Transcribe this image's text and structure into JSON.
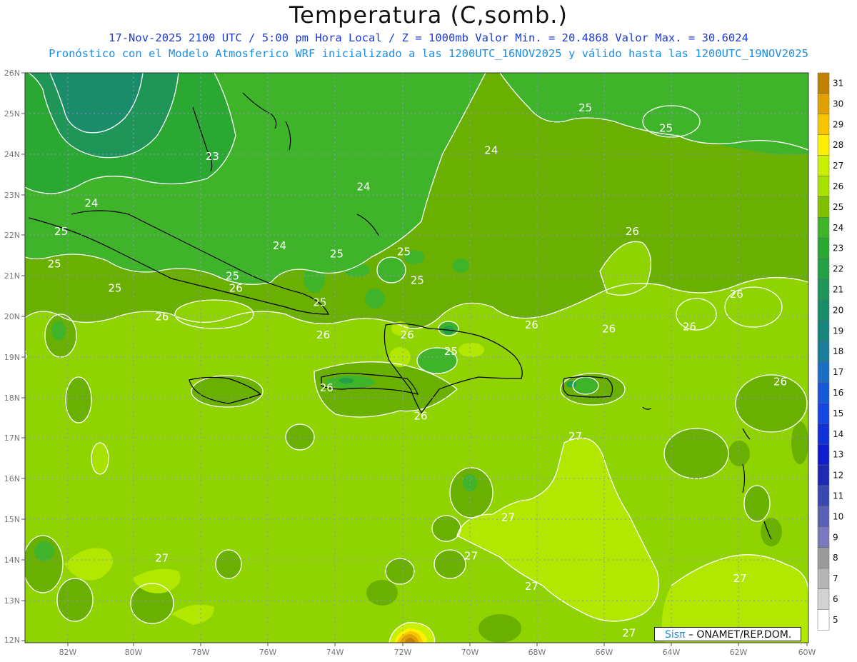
{
  "title": "Temperatura (C,somb.)",
  "subtitle_line1": "17-Nov-2025 2100 UTC / 5:00 pm Hora Local / Z = 1000mb   Valor Min. = 20.4868  Valor Max. = 30.6024",
  "subtitle_line2": "Pronóstico con el Modelo Atmosferico WRF inicializado a las 1200UTC_16NOV2025 y válido hasta las  1200UTC_19NOV2025",
  "lat_labels": [
    "26N",
    "25N",
    "24N",
    "23N",
    "22N",
    "21N",
    "20N",
    "19N",
    "18N",
    "17N",
    "16N",
    "15N",
    "14N",
    "13N",
    "12N"
  ],
  "lon_labels": [
    "82W",
    "80W",
    "78W",
    "76W",
    "74W",
    "72W",
    "70W",
    "68W",
    "66W",
    "64W",
    "62W",
    "60W"
  ],
  "colorbar": {
    "labels": [
      "31",
      "30",
      "29",
      "28",
      "27",
      "26",
      "25",
      "24",
      "23",
      "22",
      "21",
      "20",
      "19",
      "18",
      "17",
      "16",
      "15",
      "14",
      "13",
      "12",
      "11",
      "10",
      "9",
      "8",
      "7",
      "6",
      "5"
    ],
    "colors": [
      "#c08000",
      "#e0a000",
      "#f6c400",
      "#fff000",
      "#c8f000",
      "#a8e000",
      "#7ec000",
      "#3fb42a",
      "#2aa832",
      "#24a046",
      "#1f9658",
      "#1a8c6a",
      "#17857e",
      "#1a7e9a",
      "#1a6fc4",
      "#1658d8",
      "#1446e0",
      "#1232d8",
      "#0f1ecc",
      "#1e2ab4",
      "#3a48b0",
      "#5a60b4",
      "#7c78bc",
      "#9a9a9a",
      "#b4b4b4",
      "#d2d2d2",
      "#ffffff"
    ]
  },
  "contour_labels": [
    {
      "text": "25",
      "lon": -66.6,
      "lat": 25.05
    },
    {
      "text": "25",
      "lon": -64.2,
      "lat": 24.55
    },
    {
      "text": "24",
      "lon": -69.4,
      "lat": 24.0
    },
    {
      "text": "23",
      "lon": -77.7,
      "lat": 23.85
    },
    {
      "text": "24",
      "lon": -73.2,
      "lat": 23.1
    },
    {
      "text": "24",
      "lon": -81.3,
      "lat": 22.7
    },
    {
      "text": "25",
      "lon": -82.2,
      "lat": 22.0
    },
    {
      "text": "24",
      "lon": -75.7,
      "lat": 21.65
    },
    {
      "text": "26",
      "lon": -65.2,
      "lat": 22.0
    },
    {
      "text": "25",
      "lon": -74.0,
      "lat": 21.45
    },
    {
      "text": "25",
      "lon": -72.0,
      "lat": 21.5
    },
    {
      "text": "25",
      "lon": -82.4,
      "lat": 21.2
    },
    {
      "text": "25",
      "lon": -77.1,
      "lat": 20.9
    },
    {
      "text": "26",
      "lon": -77.0,
      "lat": 20.6
    },
    {
      "text": "25",
      "lon": -71.6,
      "lat": 20.8
    },
    {
      "text": "25",
      "lon": -80.6,
      "lat": 20.6
    },
    {
      "text": "26",
      "lon": -62.1,
      "lat": 20.45
    },
    {
      "text": "25",
      "lon": -74.5,
      "lat": 20.25
    },
    {
      "text": "26",
      "lon": -79.2,
      "lat": 19.9
    },
    {
      "text": "26",
      "lon": -68.2,
      "lat": 19.7
    },
    {
      "text": "26",
      "lon": -65.9,
      "lat": 19.6
    },
    {
      "text": "26",
      "lon": -63.5,
      "lat": 19.65
    },
    {
      "text": "26",
      "lon": -74.4,
      "lat": 19.45
    },
    {
      "text": "26",
      "lon": -71.9,
      "lat": 19.45
    },
    {
      "text": "25",
      "lon": -70.6,
      "lat": 19.05
    },
    {
      "text": "26",
      "lon": -83.4,
      "lat": 18.95
    },
    {
      "text": "26",
      "lon": -74.3,
      "lat": 18.15
    },
    {
      "text": "26",
      "lon": -60.8,
      "lat": 18.3
    },
    {
      "text": "26",
      "lon": -71.5,
      "lat": 17.45
    },
    {
      "text": "27",
      "lon": -66.9,
      "lat": 16.95
    },
    {
      "text": "27",
      "lon": -68.9,
      "lat": 14.95
    },
    {
      "text": "27",
      "lon": -79.2,
      "lat": 13.95
    },
    {
      "text": "27",
      "lon": -70.0,
      "lat": 14.0
    },
    {
      "text": "27",
      "lon": -62.0,
      "lat": 13.45
    },
    {
      "text": "27",
      "lon": -68.2,
      "lat": 13.25
    },
    {
      "text": "27",
      "lon": -65.3,
      "lat": 12.1
    }
  ],
  "credit": {
    "logo": "Sisπ",
    "text": " – ONAMET/REP.DOM."
  }
}
